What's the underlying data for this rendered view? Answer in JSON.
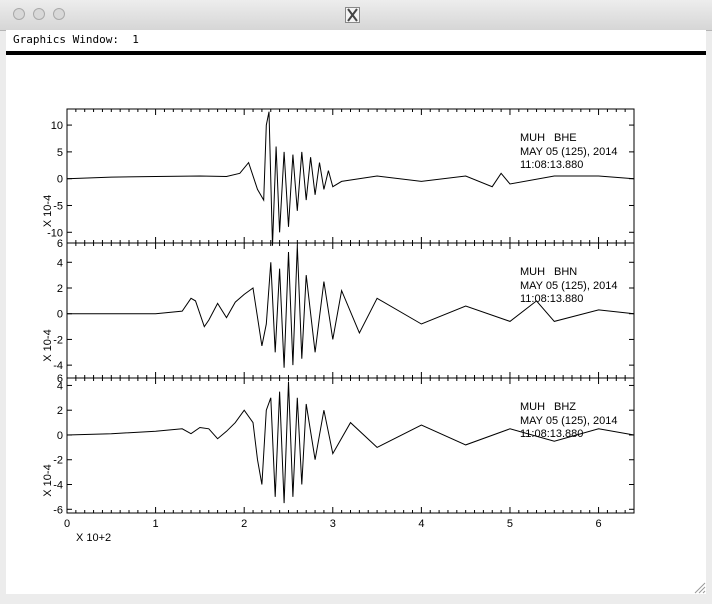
{
  "window": {
    "app_icon": "x11-icon",
    "graphics_label": "Graphics Window:  1"
  },
  "chart_data": {
    "type": "line",
    "title": "",
    "xlabel": "X 10+2",
    "x_ticks": [
      "0",
      "1",
      "2",
      "3",
      "4",
      "5",
      "6"
    ],
    "xlim": [
      0,
      6.4
    ],
    "grid": false,
    "line_color": "#000000",
    "panels": [
      {
        "station": "MUH",
        "channel": "BHE",
        "date": "MAY 05 (125), 2014",
        "time": "11:08:13.880",
        "ylabel": "X 10-4",
        "ylim": [
          -12,
          13
        ],
        "y_ticks": [
          "10",
          "5",
          "0",
          "-5",
          "-10"
        ],
        "y_tick_values": [
          10,
          5,
          0,
          -5,
          -10
        ],
        "bottom_tick": "6",
        "series": [
          {
            "x": [
              0,
              0.5,
              1,
              1.5,
              1.8,
              1.95,
              2.05,
              2.15,
              2.22,
              2.25,
              2.28,
              2.32,
              2.36,
              2.4,
              2.45,
              2.5,
              2.55,
              2.6,
              2.65,
              2.7,
              2.75,
              2.8,
              2.85,
              2.9,
              2.95,
              3.0,
              3.1,
              3.5,
              4.0,
              4.5,
              4.8,
              4.9,
              5.0,
              5.5,
              6.0,
              6.4
            ],
            "y": [
              0,
              0.3,
              0.4,
              0.5,
              0.4,
              1.0,
              3.0,
              -2.0,
              -4.0,
              10.0,
              12.5,
              -12.5,
              6.0,
              -10.0,
              5.0,
              -9.0,
              4.5,
              -6.0,
              5.0,
              -4.0,
              4.0,
              -3.0,
              3.0,
              -2.0,
              1.5,
              -1.5,
              -0.5,
              0.5,
              -0.5,
              0.5,
              -1.5,
              1.0,
              -1.0,
              0.5,
              0.5,
              0
            ]
          }
        ]
      },
      {
        "station": "MUH",
        "channel": "BHN",
        "date": "MAY 05 (125), 2014",
        "time": "11:08:13.880",
        "ylabel": "X 10-4",
        "ylim": [
          -5,
          5.5
        ],
        "y_ticks": [
          "4",
          "2",
          "0",
          "-2",
          "-4"
        ],
        "y_tick_values": [
          4,
          2,
          0,
          -2,
          -4
        ],
        "bottom_tick": "6",
        "series": [
          {
            "x": [
              0,
              0.5,
              1.0,
              1.3,
              1.4,
              1.45,
              1.55,
              1.6,
              1.7,
              1.8,
              1.9,
              2.0,
              2.1,
              2.2,
              2.25,
              2.3,
              2.35,
              2.4,
              2.45,
              2.5,
              2.55,
              2.6,
              2.65,
              2.7,
              2.8,
              2.9,
              3.0,
              3.1,
              3.3,
              3.5,
              4.0,
              4.5,
              5.0,
              5.3,
              5.5,
              6.0,
              6.4
            ],
            "y": [
              0,
              0,
              0,
              0.2,
              1.2,
              1.0,
              -1.0,
              -0.5,
              0.8,
              -0.3,
              0.9,
              1.5,
              2.0,
              -2.5,
              -0.8,
              4.0,
              -3.0,
              3.5,
              -4.2,
              4.8,
              -4.0,
              5.3,
              -3.5,
              3.0,
              -3.0,
              2.5,
              -2.0,
              1.8,
              -1.5,
              1.2,
              -0.8,
              0.6,
              -0.6,
              1.0,
              -0.6,
              0.3,
              0
            ]
          }
        ]
      },
      {
        "station": "MUH",
        "channel": "BHZ",
        "date": "MAY 05 (125), 2014",
        "time": "11:08:13.880",
        "ylabel": "X 10-4",
        "ylim": [
          -6.3,
          4.6
        ],
        "y_ticks": [
          "4",
          "2",
          "0",
          "-2",
          "-4",
          "-6"
        ],
        "y_tick_values": [
          4,
          2,
          0,
          -2,
          -4,
          -6
        ],
        "bottom_tick": "",
        "series": [
          {
            "x": [
              0,
              0.5,
              1.0,
              1.3,
              1.4,
              1.5,
              1.6,
              1.7,
              1.8,
              1.9,
              2.0,
              2.1,
              2.15,
              2.2,
              2.25,
              2.3,
              2.35,
              2.4,
              2.45,
              2.5,
              2.55,
              2.6,
              2.65,
              2.7,
              2.8,
              2.9,
              3.0,
              3.2,
              3.5,
              4.0,
              4.5,
              5.0,
              5.5,
              6.0,
              6.4
            ],
            "y": [
              0,
              0.1,
              0.3,
              0.5,
              0.1,
              0.6,
              0.5,
              -0.3,
              0.3,
              1.0,
              2.0,
              1.0,
              -2.0,
              -4.0,
              2.0,
              3.0,
              -5.0,
              3.5,
              -5.5,
              4.3,
              -5.0,
              3.0,
              -4.0,
              2.5,
              -2.0,
              2.0,
              -1.5,
              1.0,
              -1.0,
              0.8,
              -0.8,
              0.5,
              -0.5,
              0.5,
              0
            ]
          }
        ]
      }
    ]
  }
}
